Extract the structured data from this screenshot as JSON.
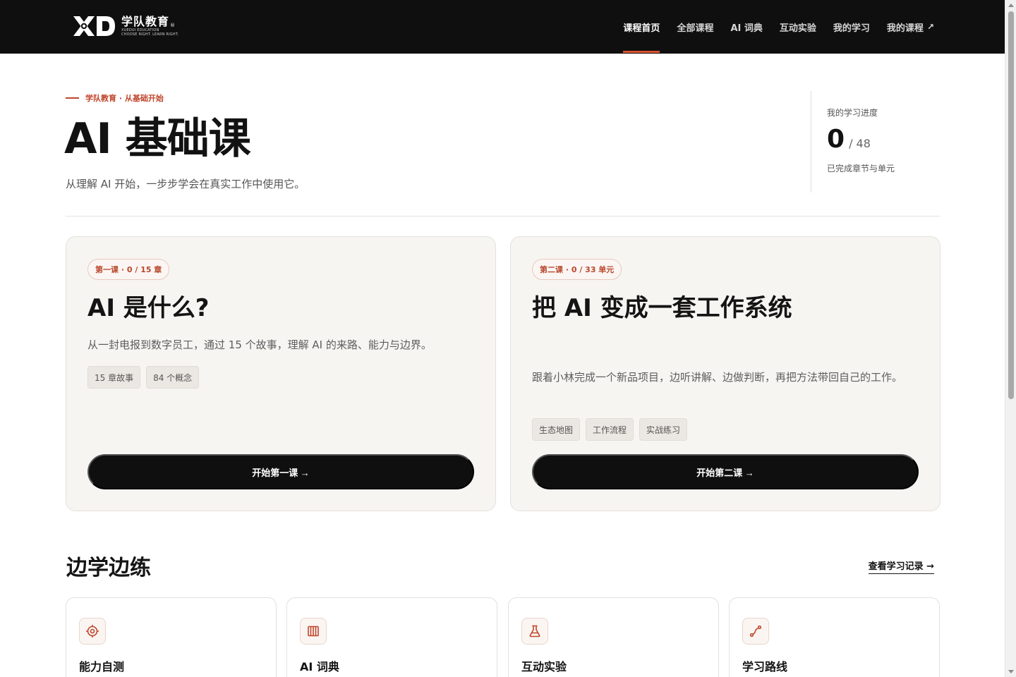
{
  "brand": {
    "mark": "XD",
    "name": "学队教育",
    "reg": "®",
    "tagline_1": "XUEDUI EDUCATION",
    "tagline_2": "CHOOSE RIGHT. LEARN RIGHT."
  },
  "nav": {
    "items": [
      {
        "label": "课程首页",
        "active": true
      },
      {
        "label": "全部课程",
        "active": false
      },
      {
        "label": "AI 词典",
        "active": false
      },
      {
        "label": "互动实验",
        "active": false
      },
      {
        "label": "我的学习",
        "active": false
      },
      {
        "label": "我的课程",
        "active": false,
        "external_icon": "↗"
      }
    ]
  },
  "hero": {
    "eyebrow": "学队教育 · 从基础开始",
    "title": "AI 基础课",
    "subtitle": "从理解 AI 开始，一步步学会在真实工作中使用它。"
  },
  "progress": {
    "label": "我的学习进度",
    "completed": "0",
    "total": "/ 48",
    "caption": "已完成章节与单元"
  },
  "courses": [
    {
      "badge": "第一课 · 0 / 15 章",
      "title": "AI 是什么?",
      "description": "从一封电报到数字员工，通过 15 个故事，理解 AI 的来路、能力与边界。",
      "tags": [
        "15 章故事",
        "84 个概念"
      ],
      "button": "开始第一课 →"
    },
    {
      "badge": "第二课 · 0 / 33 单元",
      "title": "把 AI 变成一套工作系统",
      "description": "跟着小林完成一个新品项目，边听讲解、边做判断，再把方法带回自己的工作。",
      "tags": [
        "生态地图",
        "工作流程",
        "实战练习"
      ],
      "button": "开始第二课 →"
    }
  ],
  "practice": {
    "title": "边学边练",
    "link": "查看学习记录 →",
    "items": [
      {
        "label": "能力自测",
        "icon": "target-icon"
      },
      {
        "label": "AI 词典",
        "icon": "book-icon"
      },
      {
        "label": "互动实验",
        "icon": "flask-icon"
      },
      {
        "label": "学习路线",
        "icon": "route-icon"
      }
    ]
  },
  "colors": {
    "accent": "#d9542e",
    "nav_bg": "#0f0f0f",
    "card_bg": "#f7f5f2",
    "button_bg": "#0f0f0f"
  }
}
